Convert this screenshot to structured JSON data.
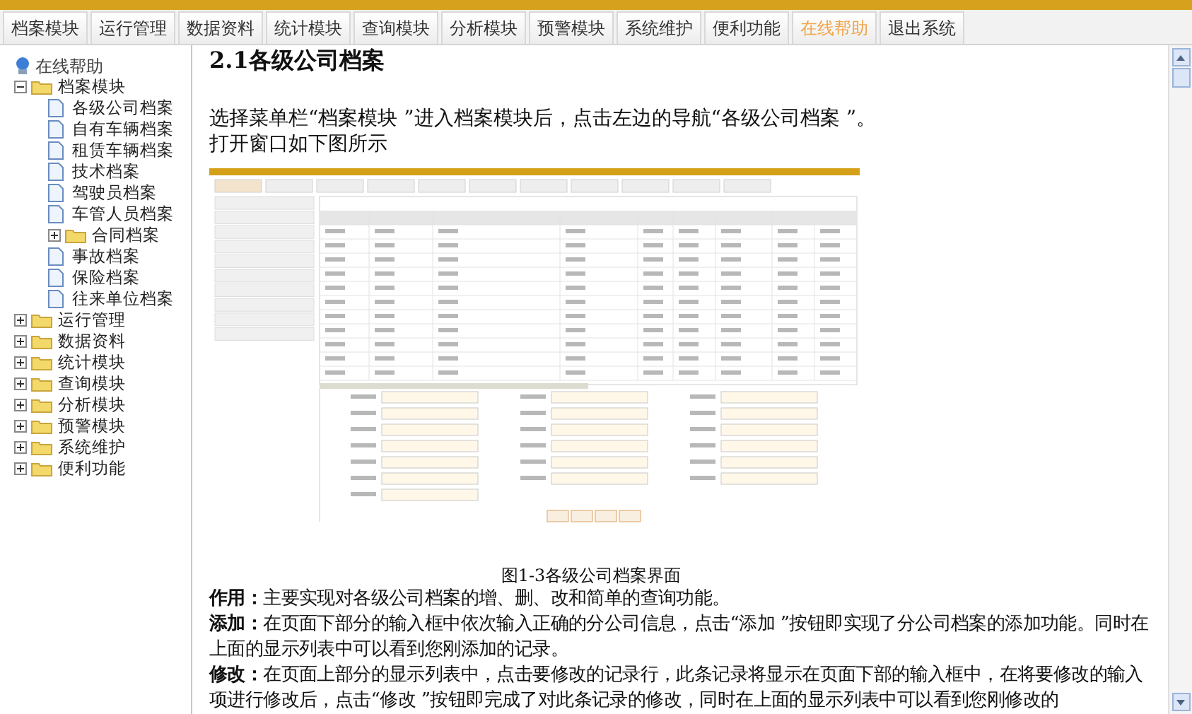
{
  "tabs": [
    {
      "label": "档案模块",
      "selected": false
    },
    {
      "label": "运行管理",
      "selected": false
    },
    {
      "label": "数据资料",
      "selected": false
    },
    {
      "label": "统计模块",
      "selected": false
    },
    {
      "label": "查询模块",
      "selected": false
    },
    {
      "label": "分析模块",
      "selected": false
    },
    {
      "label": "预警模块",
      "selected": false
    },
    {
      "label": "系统维护",
      "selected": false
    },
    {
      "label": "便利功能",
      "selected": false
    },
    {
      "label": "在线帮助",
      "selected": true
    },
    {
      "label": "退出系统",
      "selected": false
    }
  ],
  "tree": {
    "label": "在线帮助",
    "children": [
      {
        "kind": "folder",
        "label": "档案模块",
        "expanded": true,
        "children": [
          {
            "kind": "page",
            "label": "各级公司档案"
          },
          {
            "kind": "page",
            "label": "自有车辆档案"
          },
          {
            "kind": "page",
            "label": "租赁车辆档案"
          },
          {
            "kind": "page",
            "label": "技术档案"
          },
          {
            "kind": "page",
            "label": "驾驶员档案"
          },
          {
            "kind": "page",
            "label": "车管人员档案"
          },
          {
            "kind": "folder",
            "label": "合同档案",
            "expanded": false
          },
          {
            "kind": "page",
            "label": "事故档案"
          },
          {
            "kind": "page",
            "label": "保险档案"
          },
          {
            "kind": "page",
            "label": "往来单位档案"
          }
        ]
      },
      {
        "kind": "folder",
        "label": "运行管理",
        "expanded": false
      },
      {
        "kind": "folder",
        "label": "数据资料",
        "expanded": false
      },
      {
        "kind": "folder",
        "label": "统计模块",
        "expanded": false
      },
      {
        "kind": "folder",
        "label": "查询模块",
        "expanded": false
      },
      {
        "kind": "folder",
        "label": "分析模块",
        "expanded": false
      },
      {
        "kind": "folder",
        "label": "预警模块",
        "expanded": false
      },
      {
        "kind": "folder",
        "label": "系统维护",
        "expanded": false
      },
      {
        "kind": "folder",
        "label": "便利功能",
        "expanded": false
      }
    ]
  },
  "article": {
    "title": "2.1各级公司档案",
    "intro": [
      "选择菜单栏“档案模块 ”进入档案模块后，点击左边的导航“各级公司档案 ”。",
      "打开窗口如下图所示"
    ],
    "figure": {
      "caption": "图1-3各级公司档案界面"
    },
    "paragraphs": [
      "**作用：**主要实现对各级公司档案的增、删、改和简单的查询功能。",
      "**添加：**在页面下部分的输入框中依次输入正确的分公司信息，点击“添加 ”按钮即实现了分公司档案的添加功能。同时在上面的显示列表中可以看到您刚添加的记录。",
      "**修改：**在页面上部分的显示列表中，点击要修改的记录行，此条记录将显示在页面下部的输入框中，在将要修改的输入项进行修改后，点击“修改 ”按钮即完成了对此条记录的修改，同时在上面的显示列表中可以看到您刚修改的"
    ]
  }
}
